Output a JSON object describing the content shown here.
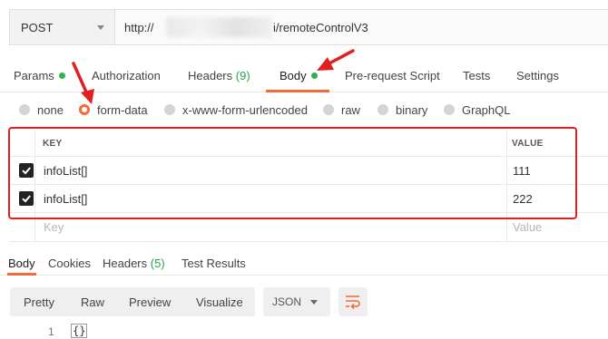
{
  "request": {
    "method": "POST",
    "url_prefix": "http://",
    "url_suffix": "i/remoteControlV3"
  },
  "request_tabs": {
    "params": "Params",
    "authorization": "Authorization",
    "headers": "Headers",
    "headers_count": "(9)",
    "body": "Body",
    "pre_request": "Pre-request Script",
    "tests": "Tests",
    "settings": "Settings",
    "active": "Body"
  },
  "body_types": {
    "none": "none",
    "form_data": "form-data",
    "urlencoded": "x-www-form-urlencoded",
    "raw": "raw",
    "binary": "binary",
    "graphql": "GraphQL",
    "selected": "form-data"
  },
  "form_table": {
    "headers": [
      "KEY",
      "VALUE"
    ],
    "rows": [
      {
        "key": "infoList[]",
        "value": "111",
        "checked": true
      },
      {
        "key": "infoList[]",
        "value": "222",
        "checked": true
      }
    ],
    "key_placeholder": "Key",
    "value_placeholder": "Value"
  },
  "response_tabs": {
    "body": "Body",
    "cookies": "Cookies",
    "headers": "Headers",
    "headers_count": "(5)",
    "test_results": "Test Results",
    "active": "Body"
  },
  "response_toolbar": {
    "views": [
      "Pretty",
      "Raw",
      "Preview",
      "Visualize"
    ],
    "format": "JSON"
  },
  "response_body": {
    "line_number": "1",
    "content": "{}"
  },
  "colors": {
    "accent": "#f26b3a",
    "status_dot": "#2fb34a",
    "annotation": "#e02020"
  }
}
